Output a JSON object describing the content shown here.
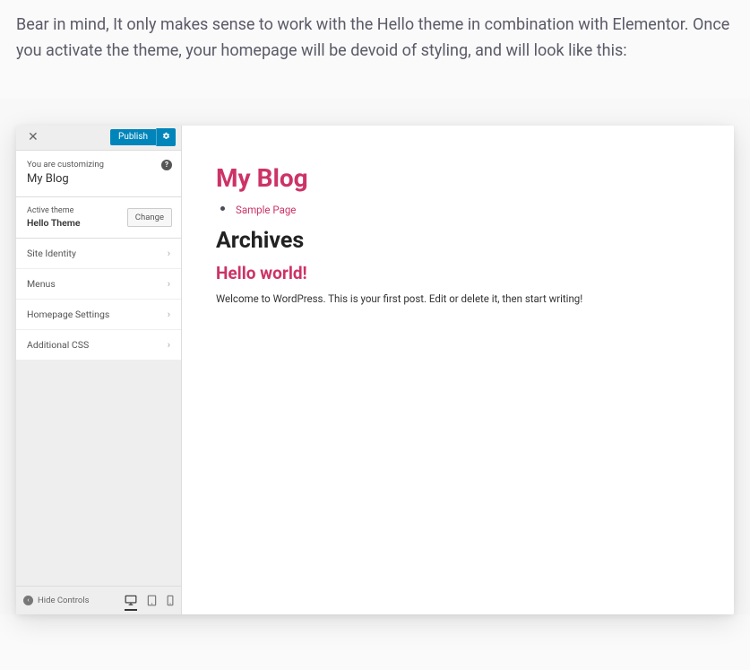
{
  "intro": "Bear in mind, It only makes sense to work with the Hello theme in combination with Elementor. Once you activate the theme, your homepage will be devoid of styling, and will look like this:",
  "customizer": {
    "publish_label": "Publish",
    "customizing_label": "You are customizing",
    "site_name": "My Blog",
    "active_theme_label": "Active theme",
    "active_theme_name": "Hello Theme",
    "change_label": "Change",
    "menu_items": [
      "Site Identity",
      "Menus",
      "Homepage Settings",
      "Additional CSS"
    ],
    "hide_controls_label": "Hide Controls"
  },
  "preview": {
    "site_title": "My Blog",
    "nav_link": "Sample Page",
    "archives_heading": "Archives",
    "post_title": "Hello world!",
    "post_body": "Welcome to WordPress. This is your first post. Edit or delete it, then start writing!"
  }
}
